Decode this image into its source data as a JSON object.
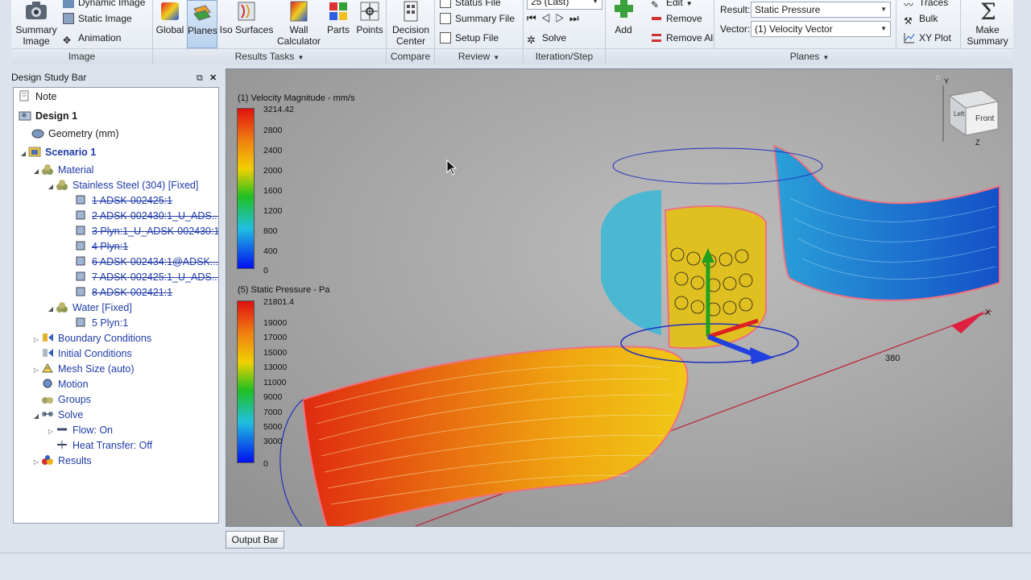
{
  "ribbon": {
    "image_group": {
      "label": "Image",
      "summary_image": "Summary\nImage",
      "dynamic_image": "Dynamic Image",
      "static_image": "Static Image",
      "animation": "Animation"
    },
    "results_tasks": {
      "label": "Results Tasks",
      "buttons": [
        "Global",
        "Planes",
        "Iso Surfaces",
        "Wall\nCalculator",
        "Parts",
        "Points"
      ]
    },
    "compare": {
      "label": "Compare",
      "decision_center": "Decision\nCenter"
    },
    "review": {
      "label": "Review",
      "status_file": "Status File",
      "summary_file": "Summary File",
      "setup_file": "Setup File"
    },
    "iteration": {
      "label": "Iteration/Step",
      "combo_value": "25 (Last)",
      "solve": "Solve"
    },
    "planes": {
      "label": "Planes",
      "add": "Add",
      "edit": "Edit",
      "remove": "Remove",
      "remove_all": "Remove All",
      "result_label": "Result:",
      "result_value": "Static Pressure",
      "vector_label": "Vector:",
      "vector_value": "(1) Velocity Vector",
      "traces": "Traces",
      "bulk": "Bulk",
      "xy_plot": "XY Plot",
      "make_summary": "Make\nSummary"
    }
  },
  "design_study_bar": {
    "title": "Design Study Bar",
    "items": [
      {
        "label": "Note"
      },
      {
        "label": "Design 1"
      },
      {
        "label": "Geometry (mm)"
      },
      {
        "label": "Scenario 1"
      },
      {
        "label": "Material"
      },
      {
        "label": "Stainless Steel (304) [Fixed]"
      },
      {
        "label": "1 ADSK-002425:1"
      },
      {
        "label": "2 ADSK-002430:1_U_ADS..."
      },
      {
        "label": "3 Plyn:1_U_ADSK-002430:1"
      },
      {
        "label": "4 Plyn:1"
      },
      {
        "label": "6 ADSK-002434:1@ADSK..."
      },
      {
        "label": "7 ADSK-002425:1_U_ADS..."
      },
      {
        "label": "8 ADSK-002421:1"
      },
      {
        "label": "Water [Fixed]"
      },
      {
        "label": "5 Plyn:1"
      },
      {
        "label": "Boundary Conditions"
      },
      {
        "label": "Initial Conditions"
      },
      {
        "label": "Mesh Size (auto)"
      },
      {
        "label": "Motion"
      },
      {
        "label": "Groups"
      },
      {
        "label": "Solve"
      },
      {
        "label": "Flow: On"
      },
      {
        "label": "Heat Transfer: Off"
      },
      {
        "label": "Results"
      }
    ]
  },
  "viewport": {
    "legend_velocity": {
      "title": "(1) Velocity Magnitude - mm/s",
      "labels": [
        "3214.42",
        "2800",
        "2400",
        "2000",
        "1600",
        "1200",
        "800",
        "400",
        "0"
      ]
    },
    "legend_pressure": {
      "title": "(5) Static Pressure - Pa",
      "labels": [
        "21801.4",
        "19000",
        "17000",
        "15000",
        "13000",
        "11000",
        "9000",
        "7000",
        "5000",
        "3000",
        "0"
      ]
    },
    "axis_x": "X",
    "axis_y": "Y",
    "axis_z": "Z",
    "ruler_value": "380",
    "viewcube_front": "Front",
    "viewcube_left": "Left"
  },
  "output_bar": "Output Bar"
}
